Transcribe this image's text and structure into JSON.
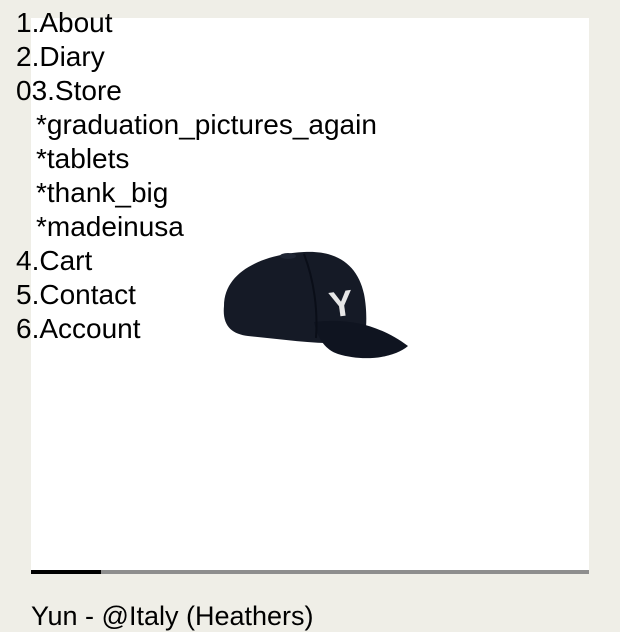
{
  "nav": {
    "items": [
      {
        "label": "1.About",
        "sub": false
      },
      {
        "label": "2.Diary",
        "sub": false
      },
      {
        "label": "03.Store",
        "sub": false
      },
      {
        "label": "*graduation_pictures_again",
        "sub": true
      },
      {
        "label": "*tablets",
        "sub": true
      },
      {
        "label": "*thank_big",
        "sub": true
      },
      {
        "label": "*madeinusa",
        "sub": true
      },
      {
        "label": "4.Cart",
        "sub": false
      },
      {
        "label": "5.Contact",
        "sub": false
      },
      {
        "label": "6.Account",
        "sub": false
      }
    ]
  },
  "product": {
    "image_icon": "baseball-cap-image",
    "cap_letter": "Y",
    "cap_color": "#151a26",
    "letter_color": "#e6e6e6"
  },
  "gallery": {
    "progress": 0.125,
    "track_color": "#8e8e8e",
    "fill_color": "#000000"
  },
  "caption": {
    "text": "Yun - @Italy (Heathers)"
  },
  "colors": {
    "background": "#efeee7",
    "panel": "#ffffff"
  }
}
